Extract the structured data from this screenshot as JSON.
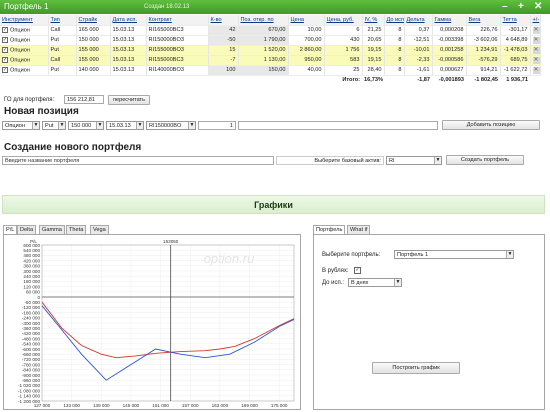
{
  "window": {
    "title": "Портфель 1",
    "created": "Создан 18.02.13",
    "controls": [
      "–",
      "+",
      "✕"
    ]
  },
  "table": {
    "columns": [
      "Инструмент",
      "Тип",
      "Страйк",
      "Дата исп.",
      "Контракт",
      "К-во",
      "Поз. откр. по",
      "Цена",
      "Цена, руб.",
      "IV, %",
      "До исп.",
      "Дельта",
      "Гамма",
      "Вега",
      "Тетта",
      "+/-"
    ],
    "rows": [
      [
        "Опцион",
        "Call",
        "165 000",
        "15.03.13",
        "RI165000BC3",
        "42",
        "670,00",
        "10,00",
        "6",
        "21,25",
        "8",
        "0,37",
        "0,000208",
        "226,76",
        "-301,17"
      ],
      [
        "Опцион",
        "Put",
        "150 000",
        "15.03.13",
        "RI150000BO3",
        "-50",
        "1 790,00",
        "700,00",
        "430",
        "20,65",
        "8",
        "-12,51",
        "-0,003398",
        "-3 602,06",
        "4 648,89"
      ],
      [
        "Опцион",
        "Put",
        "155 000",
        "15.03.13",
        "RI155000BO3",
        "15",
        "1 520,00",
        "2 860,00",
        "1 756",
        "19,15",
        "8",
        "-10,01",
        "0,001258",
        "1 234,91",
        "-1 478,03"
      ],
      [
        "Опцион",
        "Call",
        "155 000",
        "15.03.13",
        "RI155000BC3",
        "-7",
        "1 130,00",
        "950,00",
        "583",
        "19,15",
        "8",
        "-2,33",
        "-0,000586",
        "-576,29",
        "689,75"
      ],
      [
        "Опцион",
        "Put",
        "140 000",
        "15.03.13",
        "RI140000BO3",
        "100",
        "150,00",
        "40,00",
        "25",
        "28,40",
        "8",
        "-1,61",
        "0,000627",
        "914,21",
        "-1 622,72"
      ]
    ],
    "totals": {
      "label": "Итого:",
      "iv": "16,73%",
      "delta": "-1,87",
      "gamma": "-0,001893",
      "vega": "-1 802,45",
      "theta": "1 936,71"
    }
  },
  "go": {
    "label": "ГО для портфеля:",
    "value": "156 212,81",
    "recalc": "пересчитать"
  },
  "new_position": {
    "title": "Новая позиция",
    "type": "Опцион",
    "kind": "Put",
    "strike": "150 000",
    "date": "15.03.13",
    "contract": "RI150000BO",
    "qty": "1",
    "add": "Добавить позицию"
  },
  "new_portfolio": {
    "title": "Создание нового портфеля",
    "name_placeholder": "Введите название портфеля",
    "asset_label": "Выберите базовый актив:",
    "asset": "RI",
    "create": "Создать портфель"
  },
  "charts": {
    "title": "Графики",
    "tabs": [
      "P/L",
      "Delta",
      "Gamma",
      "Theta",
      "Vega"
    ],
    "ylabel": "P/L",
    "top_label": "153050",
    "watermark": "option.ru"
  },
  "right": {
    "tabs": [
      "Портфель",
      "What if"
    ],
    "portfolio_label": "Выберите портфель:",
    "portfolio": "Портфель 1",
    "rub_label": "В рублях:",
    "rub_checked": "✓",
    "exp_label": "До исп.:",
    "exp_value": "В днях",
    "build": "Построить график"
  },
  "chart_data": {
    "type": "line",
    "ylim": [
      -1200000,
      600000
    ],
    "yticks": [
      "600 000",
      "540 000",
      "480 000",
      "420 000",
      "360 000",
      "300 000",
      "240 000",
      "180 000",
      "120 000",
      "60 000",
      "0",
      "-60 000",
      "-120 000",
      "-180 000",
      "-240 000",
      "-300 000",
      "-360 000",
      "-420 000",
      "-480 000",
      "-540 000",
      "-600 000",
      "-660 000",
      "-720 000",
      "-780 000",
      "-840 000",
      "-900 000",
      "-960 000",
      "-1 020 000",
      "-1 080 000",
      "-1 140 000",
      "-1 200 000"
    ],
    "xlim": [
      127000,
      178000
    ],
    "xticks": [
      "127 000",
      "133 000",
      "139 000",
      "145 000",
      "151 000",
      "157 000",
      "163 000",
      "169 000",
      "175 000"
    ],
    "current_price": 153050,
    "series": [
      {
        "color": "#d9362b",
        "x": [
          127000,
          131000,
          135000,
          139000,
          142000,
          146000,
          150000,
          155000,
          160000,
          163000,
          166000,
          170000,
          175000,
          178000
        ],
        "y": [
          -60000,
          -360000,
          -560000,
          -660000,
          -700000,
          -680000,
          -650000,
          -630000,
          -620000,
          -600000,
          -570000,
          -480000,
          -330000,
          -250000
        ]
      },
      {
        "color": "#2a55d6",
        "x": [
          127000,
          131000,
          135000,
          140000,
          145000,
          150000,
          155000,
          160000,
          165000,
          170000,
          175000,
          178000
        ],
        "y": [
          -100000,
          -380000,
          -660000,
          -960000,
          -780000,
          -600000,
          -660000,
          -700000,
          -660000,
          -520000,
          -340000,
          -260000
        ]
      }
    ]
  }
}
